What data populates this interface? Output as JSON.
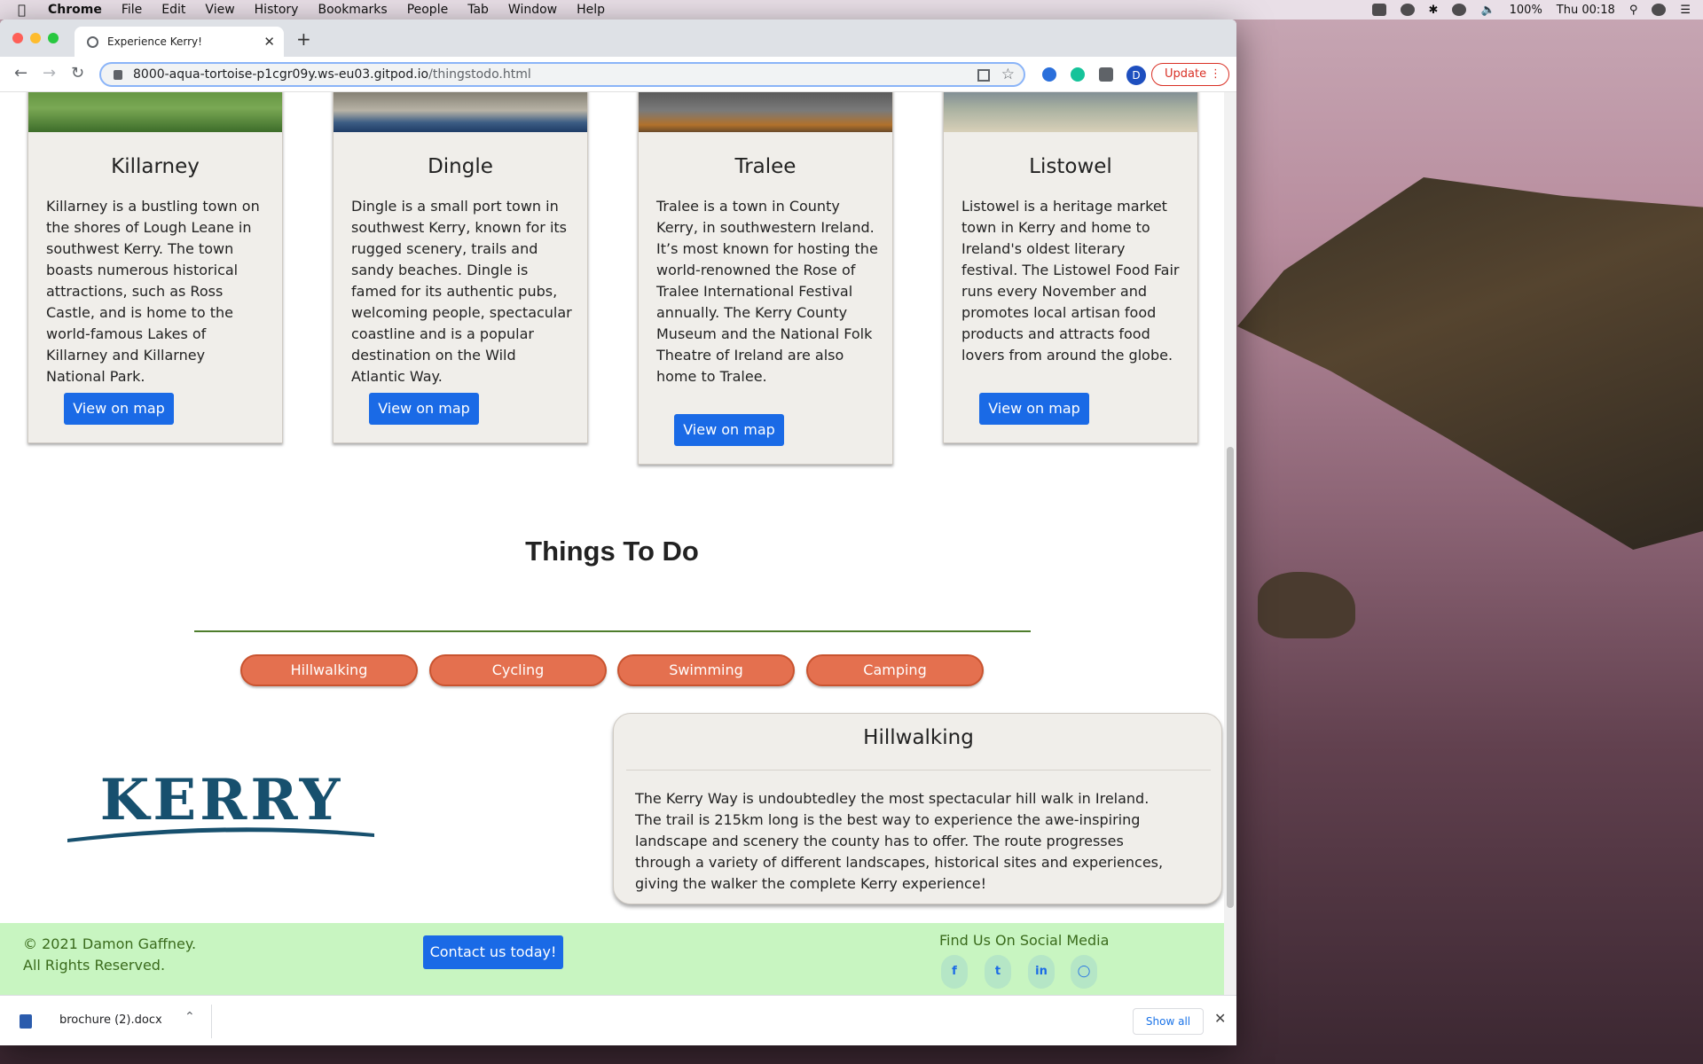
{
  "menubar": {
    "app": "Chrome",
    "items": [
      "File",
      "Edit",
      "View",
      "History",
      "Bookmarks",
      "People",
      "Tab",
      "Window",
      "Help"
    ],
    "battery": "100%",
    "clock": "Thu 00:18"
  },
  "browser": {
    "tab_title": "Experience Kerry!",
    "url_host": "8000-aqua-tortoise-p1cgr09y.ws-eu03.gitpod.io",
    "url_path": "/thingstodo.html",
    "profile_initial": "D",
    "update_label": "Update"
  },
  "towns": [
    {
      "name": "Killarney",
      "text": "Killarney is a bustling town on the shores of Lough Leane in southwest Kerry. The town boasts numerous historical attractions, such as Ross Castle, and is home to the world-famous Lakes of Killarney and Killarney National Park.",
      "button": "View on map"
    },
    {
      "name": "Dingle",
      "text": "Dingle is a small port town in southwest Kerry, known for its rugged scenery, trails and sandy beaches. Dingle is famed for its authentic pubs, welcoming people, spectacular coastline and is a popular destination on the Wild Atlantic Way.",
      "button": "View on map"
    },
    {
      "name": "Tralee",
      "text": "Tralee is a town in County Kerry, in southwestern Ireland. It’s most known for hosting the world-renowned the Rose of Tralee International Festival annually. The Kerry County Museum and the National Folk Theatre of Ireland are also home to Tralee.",
      "button": "View on map"
    },
    {
      "name": "Listowel",
      "text": "Listowel is a heritage market town in Kerry and home to Ireland's oldest literary festival. The Listowel Food Fair runs every November and promotes local artisan food products and attracts food lovers from around the globe.",
      "button": "View on map"
    }
  ],
  "things_to_do": {
    "heading": "Things To Do",
    "tabs": [
      "Hillwalking",
      "Cycling",
      "Swimming",
      "Camping"
    ],
    "active_title": "Hillwalking",
    "active_text": "The Kerry Way is undoubtedley the most spectacular hill walk in Ireland. The trail is 215km long is the best way to experience the awe-inspiring landscape and scenery the county has to offer. The route progresses through a variety of different landscapes, historical sites and experiences, giving the walker the complete Kerry experience!"
  },
  "logo": {
    "text": "KERRY",
    "color": "#17506e"
  },
  "footer": {
    "copyright_line1": "© 2021 Damon Gaffney.",
    "copyright_line2": "All Rights Reserved.",
    "contact_button": "Contact us today!",
    "social_title": "Find Us On Social Media",
    "social_icons": [
      "facebook-icon",
      "twitter-icon",
      "linkedin-icon",
      "instagram-icon"
    ]
  },
  "downloads": {
    "file_name": "brochure (2).docx",
    "show_all": "Show all"
  },
  "colors": {
    "accent_blue": "#1a6ae6",
    "pill": "#e4704f",
    "footer_bg": "#c8f5c1",
    "footer_text": "#3a6b1c",
    "rule": "#4e7d2c"
  }
}
